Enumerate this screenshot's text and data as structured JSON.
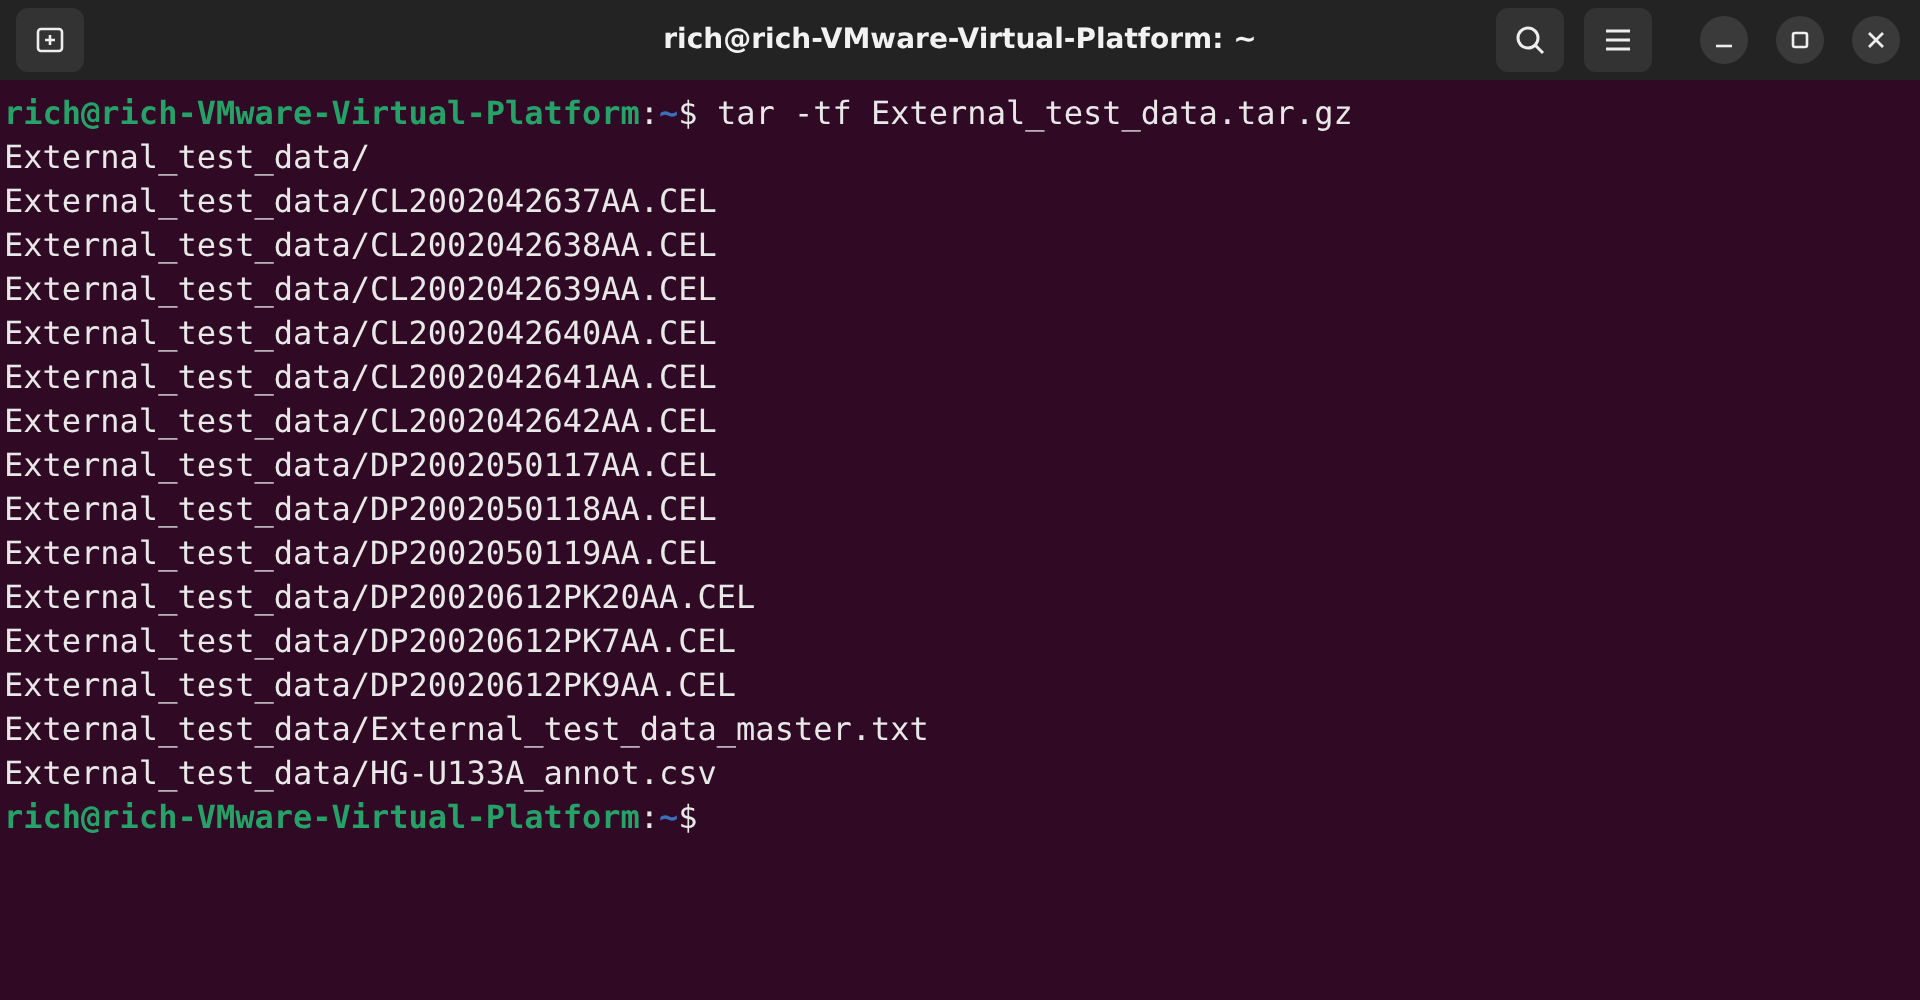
{
  "window": {
    "title": "rich@rich-VMware-Virtual-Platform: ~"
  },
  "terminal": {
    "lines": [
      {
        "kind": "prompt",
        "user_host": "rich@rich-VMware-Virtual-Platform",
        "separator": ":",
        "path": "~",
        "symbol": "$",
        "command": "tar -tf External_test_data.tar.gz"
      },
      {
        "kind": "output",
        "text": "External_test_data/"
      },
      {
        "kind": "output",
        "text": "External_test_data/CL2002042637AA.CEL"
      },
      {
        "kind": "output",
        "text": "External_test_data/CL2002042638AA.CEL"
      },
      {
        "kind": "output",
        "text": "External_test_data/CL2002042639AA.CEL"
      },
      {
        "kind": "output",
        "text": "External_test_data/CL2002042640AA.CEL"
      },
      {
        "kind": "output",
        "text": "External_test_data/CL2002042641AA.CEL"
      },
      {
        "kind": "output",
        "text": "External_test_data/CL2002042642AA.CEL"
      },
      {
        "kind": "output",
        "text": "External_test_data/DP2002050117AA.CEL"
      },
      {
        "kind": "output",
        "text": "External_test_data/DP2002050118AA.CEL"
      },
      {
        "kind": "output",
        "text": "External_test_data/DP2002050119AA.CEL"
      },
      {
        "kind": "output",
        "text": "External_test_data/DP20020612PK20AA.CEL"
      },
      {
        "kind": "output",
        "text": "External_test_data/DP20020612PK7AA.CEL"
      },
      {
        "kind": "output",
        "text": "External_test_data/DP20020612PK9AA.CEL"
      },
      {
        "kind": "output",
        "text": "External_test_data/External_test_data_master.txt"
      },
      {
        "kind": "output",
        "text": "External_test_data/HG-U133A_annot.csv"
      },
      {
        "kind": "prompt",
        "user_host": "rich@rich-VMware-Virtual-Platform",
        "separator": ":",
        "path": "~",
        "symbol": "$"
      }
    ]
  }
}
